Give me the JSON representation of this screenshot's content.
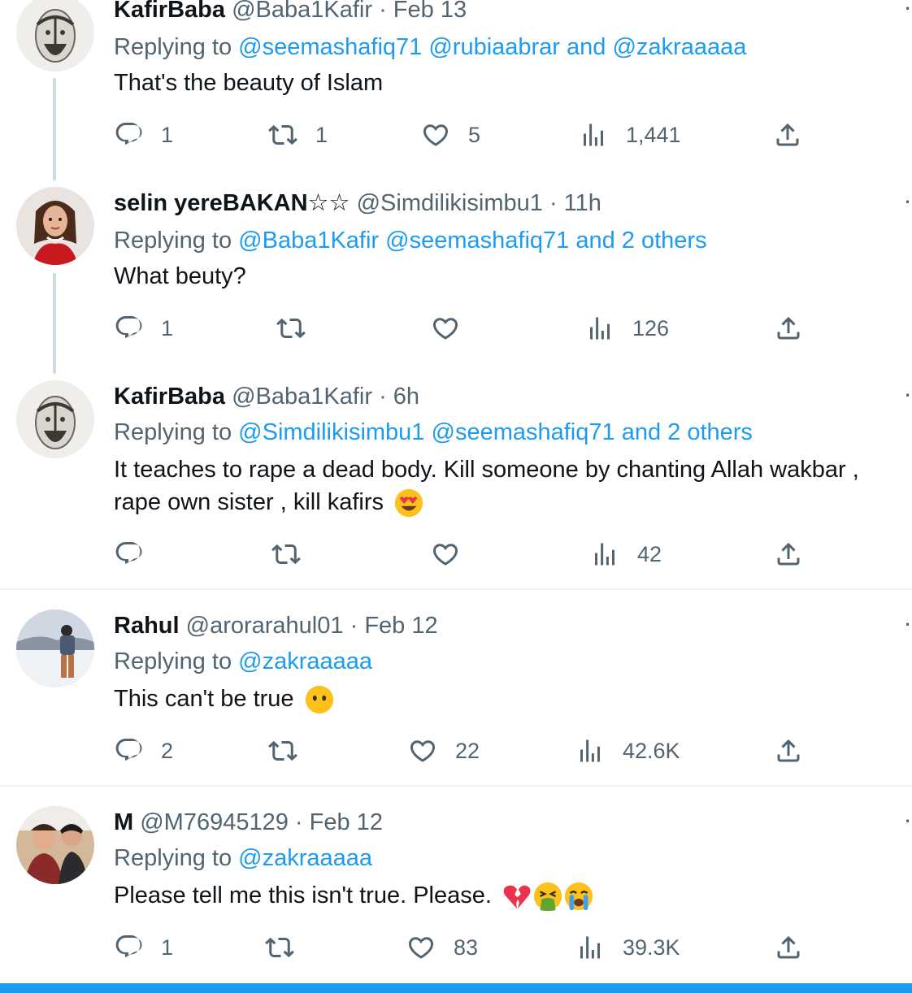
{
  "tweets": [
    {
      "name": "KafirBaba",
      "handle": "@Baba1Kafir",
      "time": "Feb 13",
      "replying_to_label": "Replying to",
      "mention_1": "@seemashafiq71",
      "mention_2": "@rubiaabrar",
      "joiner": "and",
      "mention_3": "@zakraaaaa",
      "text": "That's the beauty of Islam",
      "counts": {
        "reply": "1",
        "retweet": "1",
        "like": "5",
        "views": "1,441"
      }
    },
    {
      "name": "selin yereBAKAN☆☆",
      "handle": "@Simdilikisimbu1",
      "time": "11h",
      "replying_to_label": "Replying to",
      "mention_1": "@Baba1Kafir",
      "mention_2": "@seemashafiq71",
      "joiner": "and",
      "mention_3": "2 others",
      "text": "What beuty?",
      "counts": {
        "reply": "1",
        "retweet": "",
        "like": "",
        "views": "126"
      }
    },
    {
      "name": "KafirBaba",
      "handle": "@Baba1Kafir",
      "time": "6h",
      "replying_to_label": "Replying to",
      "mention_1": "@Simdilikisimbu1",
      "mention_2": "@seemashafiq71",
      "joiner": "and",
      "mention_3": "2 others",
      "text_line_1": "It teaches to rape a dead body. Kill someone by chanting Allah wakbar ,",
      "text_line_2": "rape own sister , kill kafirs",
      "emojis": [
        "heart-eyes-emoji"
      ],
      "counts": {
        "reply": "",
        "retweet": "",
        "like": "",
        "views": "42"
      }
    },
    {
      "name": "Rahul",
      "handle": "@arorarahul01",
      "time": "Feb 12",
      "replying_to_label": "Replying to",
      "mention_1": "@zakraaaaa",
      "text": "This can't be true",
      "emojis": [
        "no-mouth-emoji"
      ],
      "counts": {
        "reply": "2",
        "retweet": "",
        "like": "22",
        "views": "42.6K"
      }
    },
    {
      "name": "M",
      "handle": "@M76945129",
      "time": "Feb 12",
      "replying_to_label": "Replying to",
      "mention_1": "@zakraaaaa",
      "text": "Please tell me this isn't true. Please.",
      "emojis": [
        "broken-heart-emoji",
        "vomiting-face-emoji",
        "crying-face-emoji"
      ],
      "counts": {
        "reply": "1",
        "retweet": "",
        "like": "83",
        "views": "39.3K"
      }
    }
  ],
  "separator": "·",
  "icons": {
    "reply": "reply-icon",
    "retweet": "retweet-icon",
    "like": "like-icon",
    "views": "views-icon",
    "share": "share-icon",
    "more": "more-icon"
  },
  "colors": {
    "link": "#1d9bf0",
    "secondary_text": "#536471",
    "primary_text": "#0f1419",
    "thread_line": "#cfd9de",
    "divider": "#eff3f4"
  }
}
